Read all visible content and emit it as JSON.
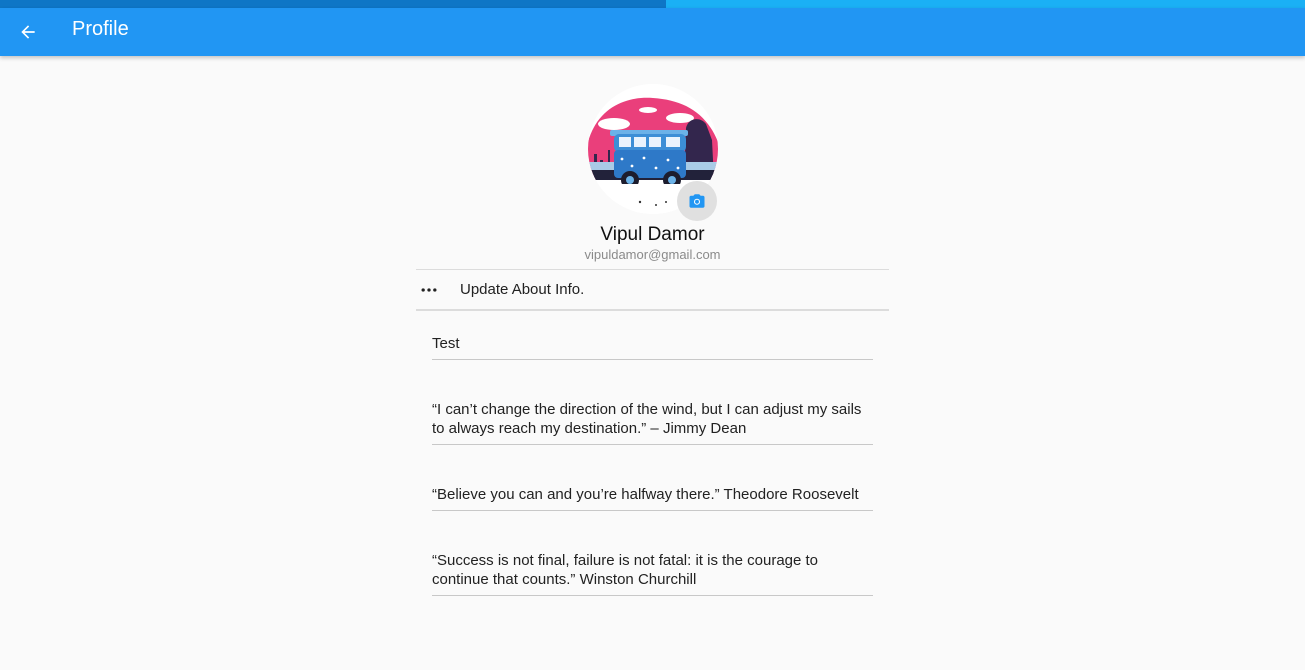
{
  "loading": {
    "progress_percent": 51
  },
  "appbar": {
    "title": "Profile",
    "color": "#2196f3"
  },
  "profile": {
    "name": "Vipul Damor",
    "email": "vipuldamor@gmail.com",
    "avatar_icon": "van-illustration",
    "camera_icon": "camera-icon"
  },
  "about": {
    "menu_icon": "more-horiz-icon",
    "label": "Update About Info."
  },
  "entries": [
    "Test",
    "“I can’t change the direction of the wind, but I can adjust my sails to always reach my destination.” – Jimmy Dean",
    " “Believe you can and you’re halfway there.” Theodore Roosevelt",
    "“Success is not final, failure is not fatal: it is the courage to continue that counts.” Winston Churchill"
  ]
}
